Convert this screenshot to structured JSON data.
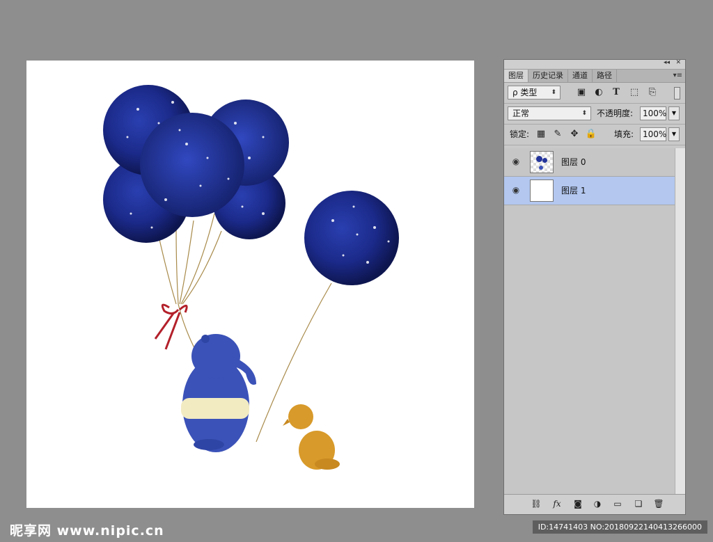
{
  "panel": {
    "top_icons": {
      "collapse": "◂◂",
      "close": "✕"
    },
    "tabs": [
      {
        "label": "图层",
        "active": true
      },
      {
        "label": "历史记录",
        "active": false
      },
      {
        "label": "通道",
        "active": false
      },
      {
        "label": "路径",
        "active": false
      }
    ],
    "tab_menu": "▾≡",
    "filter": {
      "label": "ρ 类型",
      "icons": [
        "image-filter-icon",
        "adjustment-filter-icon",
        "type-filter-icon",
        "shape-filter-icon",
        "smart-object-filter-icon"
      ]
    },
    "blend_mode": "正常",
    "opacity_label": "不透明度:",
    "opacity_value": "100%",
    "lock_label": "锁定:",
    "fill_label": "填充:",
    "fill_value": "100%",
    "layers": [
      {
        "name": "图层 0",
        "visible": true,
        "selected": false
      },
      {
        "name": "图层 1",
        "visible": true,
        "selected": true
      }
    ],
    "bottom_icons": [
      "link-icon",
      "fx-icon",
      "mask-icon",
      "adjustment-icon",
      "folder-icon",
      "new-layer-icon",
      "trash-icon"
    ]
  },
  "watermark": {
    "left": "昵享网 www.nipic.cn",
    "right": "ID:14741403 NO:20180922140413266000"
  },
  "colors": {
    "workspace": "#8e8e8e",
    "panel_bg": "#c9c9c9",
    "selected_layer": "#b3c7ef"
  }
}
